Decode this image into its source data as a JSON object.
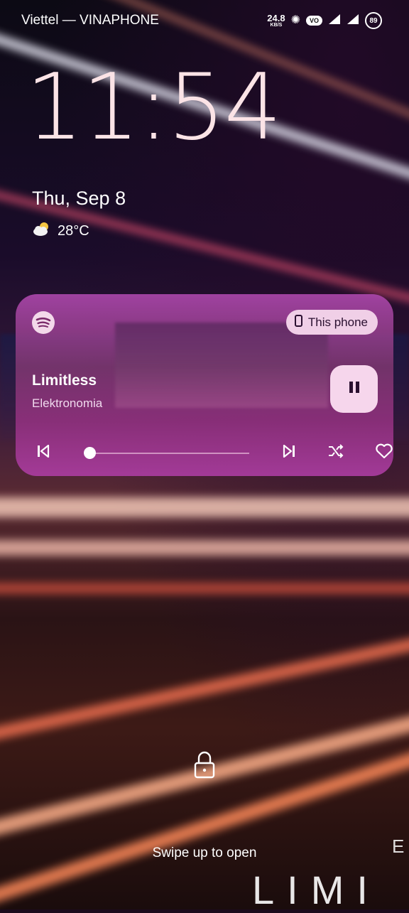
{
  "status_bar": {
    "carrier": "Viettel — VINAPHONE",
    "net_speed_value": "24.8",
    "net_speed_unit": "KB/S",
    "volte_label": "VO",
    "battery_level": "89"
  },
  "lockscreen": {
    "time": "11:54",
    "date": "Thu, Sep 8",
    "weather": {
      "icon": "partly-cloudy-icon",
      "temperature": "28°C"
    },
    "unlock_hint": "Swipe up to open",
    "wallpaper_text": "LIMI",
    "wallpaper_letter": "E"
  },
  "media_player": {
    "app_icon": "spotify-icon",
    "output_device": "This phone",
    "track_title": "Limitless",
    "artist": "Elektronomia",
    "progress_fraction": 0.03,
    "is_playing": true
  },
  "colors": {
    "clock": "#fbe3e6",
    "chip_bg": "#f0cfe7",
    "card_tint": "#a046a0"
  }
}
